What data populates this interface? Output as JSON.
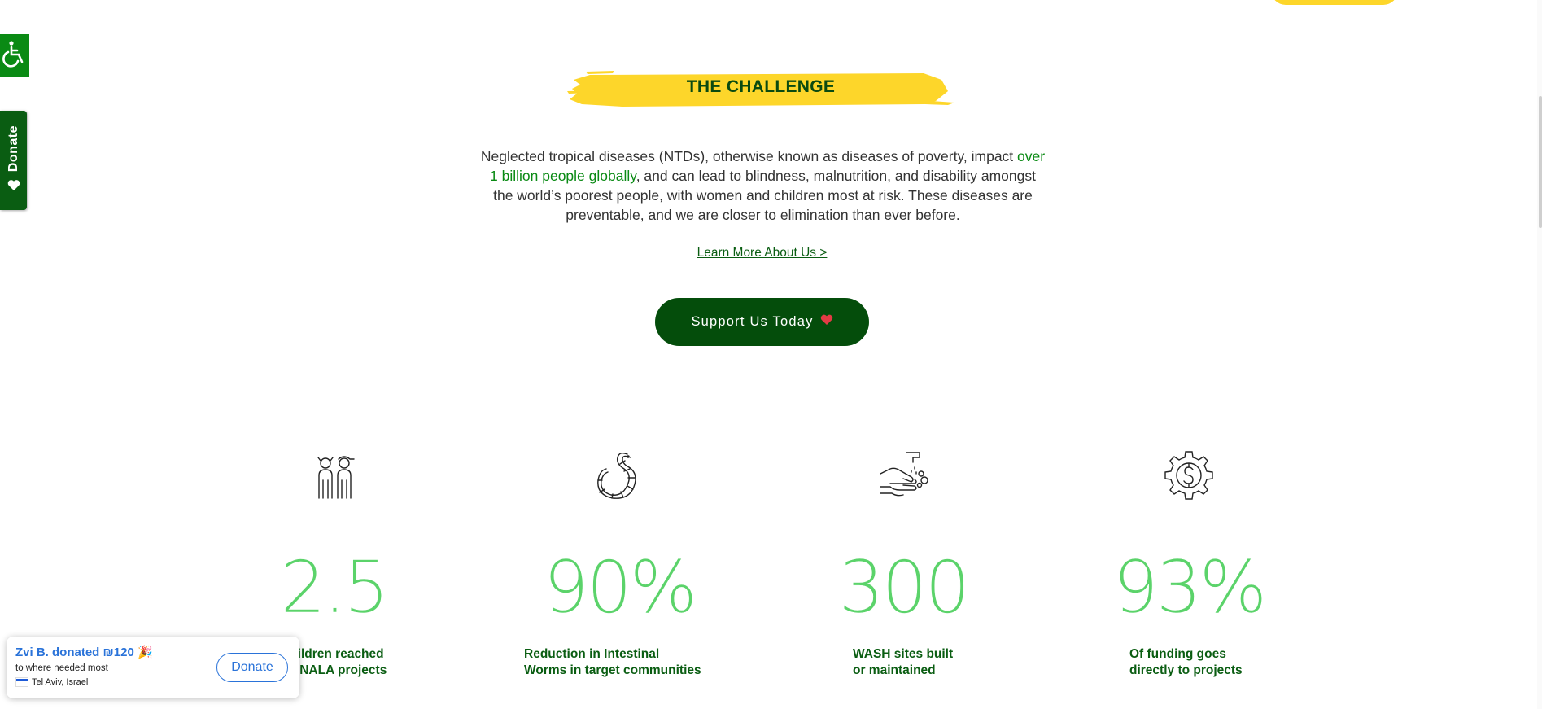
{
  "accessibility": {
    "icon": "wheelchair-icon"
  },
  "side_donate": {
    "label": "Donate",
    "icon": "heart-icon"
  },
  "challenge": {
    "heading": "THE CHALLENGE",
    "intro_part1": "Neglected tropical diseases (NTDs), otherwise known as diseases of poverty, impact ",
    "intro_highlight": "over 1 billion people globally",
    "intro_part2": ", and can lead to blindness, malnutrition, and disability amongst the world’s poorest people, with women and children most at risk. These diseases are preventable, and we are closer to elimination than ever before.",
    "learn_more": "Learn More About Us >",
    "support_button": "Support Us Today",
    "support_icon": "heart-icon"
  },
  "stats": [
    {
      "icon": "children-icon",
      "number": "2.5",
      "label_line1": "Children reached",
      "label_line2": "gh NALA projects"
    },
    {
      "icon": "worm-icon",
      "number": "90%",
      "label_line1": "Reduction in Intestinal",
      "label_line2": "Worms in target communities"
    },
    {
      "icon": "handwash-icon",
      "number": "300",
      "label_line1": "WASH sites built",
      "label_line2": "or maintained"
    },
    {
      "icon": "dollar-gear-icon",
      "number": "93%",
      "label_line1": "Of funding goes",
      "label_line2": "directly to projects"
    }
  ],
  "toast": {
    "title": "Zvi B. donated ₪120 🎉",
    "subtitle": "to where needed most",
    "location": "Tel Aviv, Israel",
    "donate_button": "Donate"
  },
  "colors": {
    "brand_green": "#044d0b",
    "accent_yellow": "#fdd62a",
    "stat_green": "#5bd36a",
    "link_blue": "#2a73d9"
  }
}
